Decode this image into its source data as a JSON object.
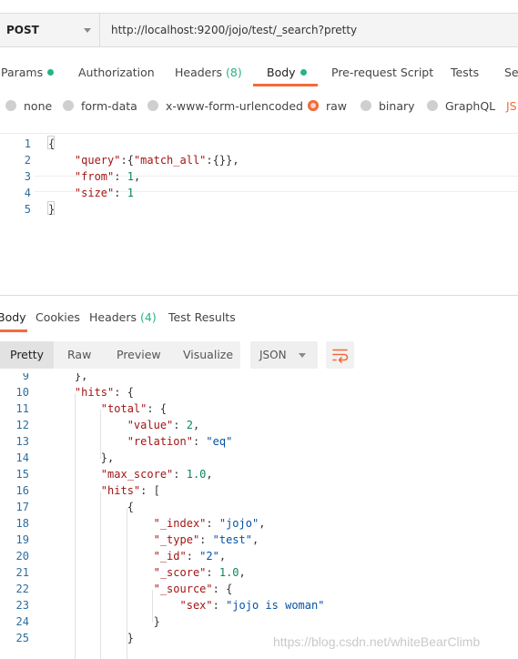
{
  "request": {
    "method": "POST",
    "url": "http://localhost:9200/jojo/test/_search?pretty"
  },
  "request_tabs": [
    {
      "label": "Params",
      "dot": true
    },
    {
      "label": "Authorization"
    },
    {
      "label": "Headers",
      "count": "(8)"
    },
    {
      "label": "Body",
      "dot": true,
      "active": true
    },
    {
      "label": "Pre-request Script"
    },
    {
      "label": "Tests"
    },
    {
      "label": "Se"
    }
  ],
  "body_types": [
    {
      "label": "none"
    },
    {
      "label": "form-data"
    },
    {
      "label": "x-www-form-urlencoded"
    },
    {
      "label": "raw",
      "selected": true
    },
    {
      "label": "binary"
    },
    {
      "label": "GraphQL"
    },
    {
      "label": "JS"
    }
  ],
  "request_body": {
    "line_numbers": [
      "1",
      "2",
      "3",
      "4",
      "5"
    ],
    "lines": [
      [
        {
          "t": "{",
          "c": "pun"
        }
      ],
      [
        {
          "t": "    "
        },
        {
          "t": "\"query\"",
          "c": "key"
        },
        {
          "t": ":{",
          "c": "pun"
        },
        {
          "t": "\"match_all\"",
          "c": "key"
        },
        {
          "t": ":{}},",
          "c": "pun"
        }
      ],
      [
        {
          "t": "    "
        },
        {
          "t": "\"from\"",
          "c": "key"
        },
        {
          "t": ": ",
          "c": "pun"
        },
        {
          "t": "1",
          "c": "num"
        },
        {
          "t": ",",
          "c": "pun"
        }
      ],
      [
        {
          "t": "    "
        },
        {
          "t": "\"size\"",
          "c": "key"
        },
        {
          "t": ": ",
          "c": "pun"
        },
        {
          "t": "1",
          "c": "num"
        }
      ],
      [
        {
          "t": "}",
          "c": "pun"
        }
      ]
    ]
  },
  "response_tabs": [
    {
      "label": "Body",
      "active": true
    },
    {
      "label": "Cookies"
    },
    {
      "label": "Headers",
      "count": "(4)"
    },
    {
      "label": "Test Results"
    }
  ],
  "view_modes": [
    {
      "label": "Pretty",
      "active": true
    },
    {
      "label": "Raw"
    },
    {
      "label": "Preview"
    },
    {
      "label": "Visualize"
    }
  ],
  "format": "JSON",
  "icons": {
    "format_dropdown": "chevron-down-icon",
    "wrap": "wrap-lines-icon"
  },
  "colors": {
    "accent": "#f26b3a",
    "indicator": "#26b47f",
    "json_key": "#a31515",
    "json_string": "#0451a5",
    "json_number": "#098658",
    "line_number": "#2d6e9e"
  },
  "response_body": {
    "line_numbers": [
      "9",
      "10",
      "11",
      "12",
      "13",
      "14",
      "15",
      "16",
      "17",
      "18",
      "19",
      "20",
      "21",
      "22",
      "23",
      "24",
      "25"
    ],
    "lines": [
      [
        {
          "t": "    },",
          "c": "pun"
        }
      ],
      [
        {
          "t": "    "
        },
        {
          "t": "\"hits\"",
          "c": "key"
        },
        {
          "t": ": {",
          "c": "pun"
        }
      ],
      [
        {
          "t": "        "
        },
        {
          "t": "\"total\"",
          "c": "key"
        },
        {
          "t": ": {",
          "c": "pun"
        }
      ],
      [
        {
          "t": "            "
        },
        {
          "t": "\"value\"",
          "c": "key"
        },
        {
          "t": ": ",
          "c": "pun"
        },
        {
          "t": "2",
          "c": "num"
        },
        {
          "t": ",",
          "c": "pun"
        }
      ],
      [
        {
          "t": "            "
        },
        {
          "t": "\"relation\"",
          "c": "key"
        },
        {
          "t": ": ",
          "c": "pun"
        },
        {
          "t": "\"eq\"",
          "c": "str"
        }
      ],
      [
        {
          "t": "        },",
          "c": "pun"
        }
      ],
      [
        {
          "t": "        "
        },
        {
          "t": "\"max_score\"",
          "c": "key"
        },
        {
          "t": ": ",
          "c": "pun"
        },
        {
          "t": "1.0",
          "c": "num"
        },
        {
          "t": ",",
          "c": "pun"
        }
      ],
      [
        {
          "t": "        "
        },
        {
          "t": "\"hits\"",
          "c": "key"
        },
        {
          "t": ": [",
          "c": "pun"
        }
      ],
      [
        {
          "t": "            {",
          "c": "pun"
        }
      ],
      [
        {
          "t": "                "
        },
        {
          "t": "\"_index\"",
          "c": "key"
        },
        {
          "t": ": ",
          "c": "pun"
        },
        {
          "t": "\"jojo\"",
          "c": "str"
        },
        {
          "t": ",",
          "c": "pun"
        }
      ],
      [
        {
          "t": "                "
        },
        {
          "t": "\"_type\"",
          "c": "key"
        },
        {
          "t": ": ",
          "c": "pun"
        },
        {
          "t": "\"test\"",
          "c": "str"
        },
        {
          "t": ",",
          "c": "pun"
        }
      ],
      [
        {
          "t": "                "
        },
        {
          "t": "\"_id\"",
          "c": "key"
        },
        {
          "t": ": ",
          "c": "pun"
        },
        {
          "t": "\"2\"",
          "c": "str"
        },
        {
          "t": ",",
          "c": "pun"
        }
      ],
      [
        {
          "t": "                "
        },
        {
          "t": "\"_score\"",
          "c": "key"
        },
        {
          "t": ": ",
          "c": "pun"
        },
        {
          "t": "1.0",
          "c": "num"
        },
        {
          "t": ",",
          "c": "pun"
        }
      ],
      [
        {
          "t": "                "
        },
        {
          "t": "\"_source\"",
          "c": "key"
        },
        {
          "t": ": {",
          "c": "pun"
        }
      ],
      [
        {
          "t": "                    "
        },
        {
          "t": "\"sex\"",
          "c": "key"
        },
        {
          "t": ": ",
          "c": "pun"
        },
        {
          "t": "\"jojo is woman\"",
          "c": "str"
        }
      ],
      [
        {
          "t": "                }",
          "c": "pun"
        }
      ],
      [
        {
          "t": "            }",
          "c": "pun"
        }
      ]
    ]
  },
  "watermark": "https://blog.csdn.net/whiteBearClimb"
}
